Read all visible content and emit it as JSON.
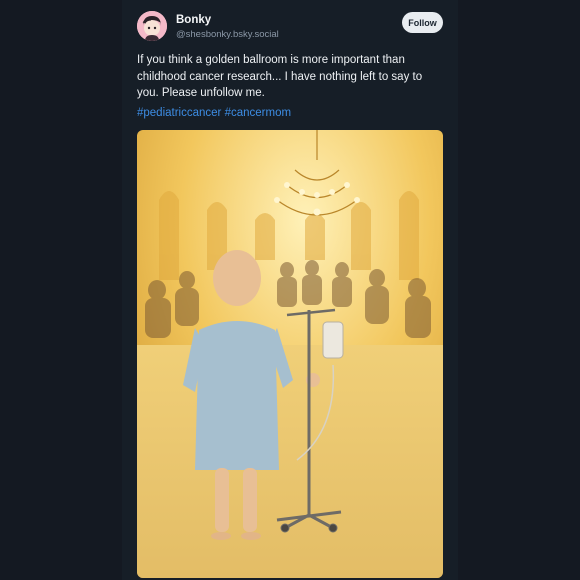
{
  "post": {
    "author": {
      "display_name": "Bonky",
      "handle": "@shesbonky.bsky.social"
    },
    "follow_label": "Follow",
    "text": "If you think a golden ballroom is more important than childhood cancer research... I have nothing left to say to you. Please unfollow me.",
    "hashtags": [
      "#pediatriccancer",
      "#cancermom"
    ]
  },
  "colors": {
    "background": "#141922",
    "accent_link": "#3d8de4",
    "follow_button": "#e8ecf0"
  }
}
